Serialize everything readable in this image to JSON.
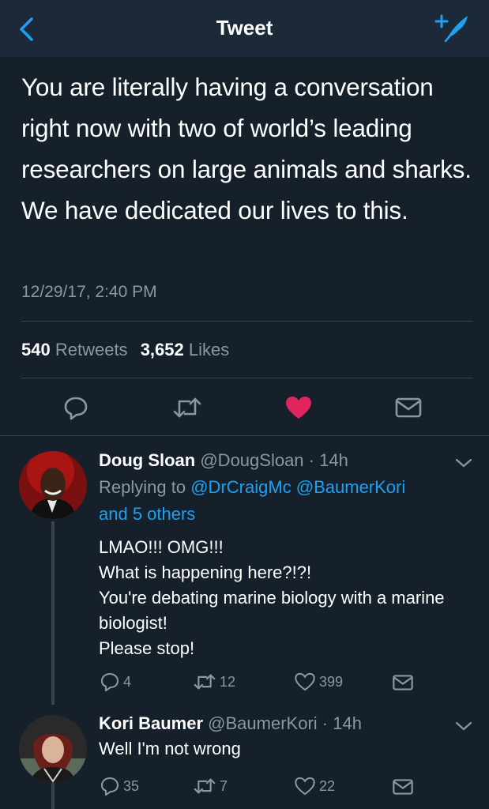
{
  "nav": {
    "title": "Tweet"
  },
  "tweet": {
    "text": "You are literally having a conversation right now with two of world’s leading researchers on large animals and sharks. We have dedicated our lives to this.",
    "timestamp": "12/29/17, 2:40 PM",
    "retweet_count": "540",
    "retweet_label": "Retweets",
    "like_count": "3,652",
    "like_label": "Likes",
    "liked": true,
    "colors": {
      "accent": "#1da1f2",
      "like": "#e0245e",
      "background": "#15202b",
      "nav": "#1c2938"
    }
  },
  "replies": [
    {
      "name": "Doug Sloan",
      "handle": "@DougSloan",
      "time": "· 14h",
      "replying_prefix": "Replying to",
      "mentions": "@DrCraigMc @BaumerKori",
      "others": "and 5 others",
      "body": "LMAO!!! OMG!!!\nWhat is happening here?!?!\nYou're debating marine biology with a marine biologist!\nPlease stop!",
      "reply_count": "4",
      "retweet_count": "12",
      "like_count": "399"
    },
    {
      "name": "Kori Baumer",
      "handle": "@BaumerKori",
      "time": "· 14h",
      "body": "Well I'm not wrong",
      "reply_count": "35",
      "retweet_count": "7",
      "like_count": "22"
    }
  ]
}
